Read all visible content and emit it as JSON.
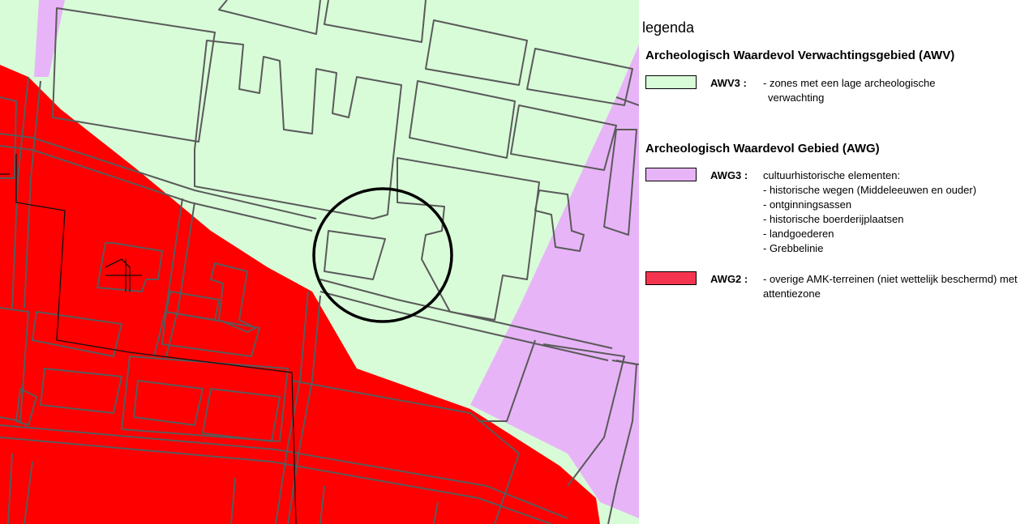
{
  "colors": {
    "awv3": "#d8fcd8",
    "awg3": "#e8b4f8",
    "awg2": "#ff0000",
    "awg2_swatch": "#f5354f",
    "lines": "#5a5a5a"
  },
  "legend": {
    "title": "legenda",
    "sections": [
      {
        "heading": "Archeologisch Waardevol Verwachtingsgebied (AWV)",
        "items": [
          {
            "code": "AWV3 :",
            "lines": [
              "- zones met een lage archeologische",
              "  verwachting"
            ]
          }
        ]
      },
      {
        "heading": "Archeologisch Waardevol Gebied (AWG)",
        "items": [
          {
            "code": "AWG3 :",
            "lines": [
              "cultuurhistorische elementen:",
              "- historische wegen (Middeleeuwen en ouder)",
              "- ontginningsassen",
              "- historische boerderijplaatsen",
              "- landgoederen",
              "- Grebbelinie"
            ]
          },
          {
            "code": "AWG2 :",
            "lines": [
              "- overige AMK-terreinen (niet wettelijk beschermd) met",
              "attentiezone"
            ]
          }
        ]
      }
    ]
  }
}
